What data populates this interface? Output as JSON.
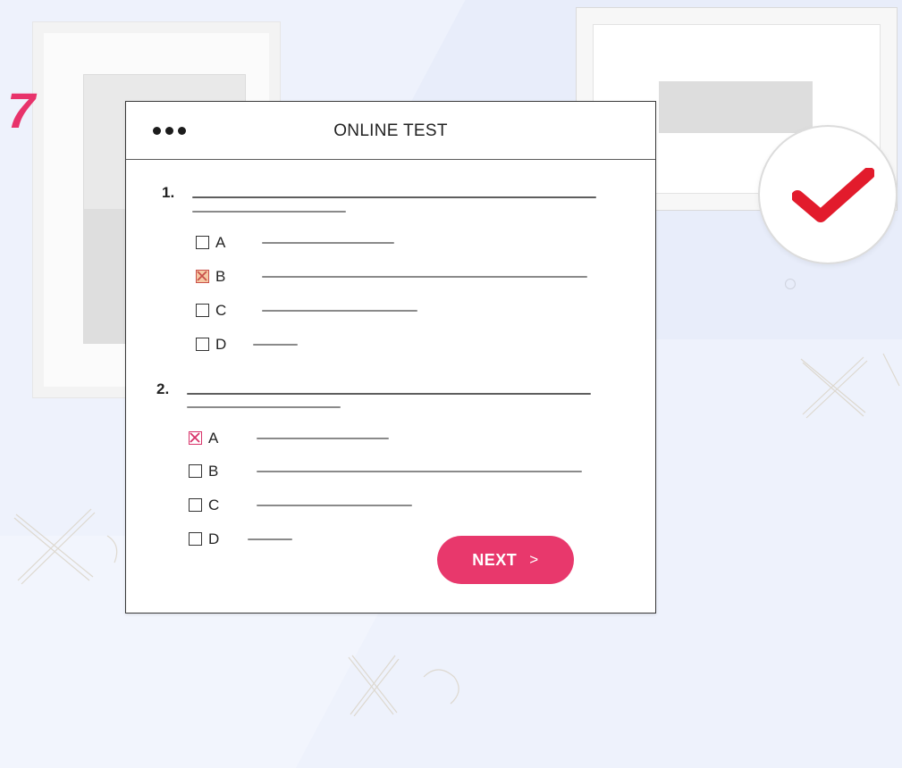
{
  "step_number": "7",
  "window": {
    "title": "ONLINE TEST"
  },
  "questions": [
    {
      "number": "1.",
      "options": [
        {
          "letter": "A",
          "state": "unchecked"
        },
        {
          "letter": "B",
          "state": "checked"
        },
        {
          "letter": "C",
          "state": "unchecked"
        },
        {
          "letter": "D",
          "state": "unchecked"
        }
      ]
    },
    {
      "number": "2.",
      "options": [
        {
          "letter": "A",
          "state": "checked"
        },
        {
          "letter": "B",
          "state": "unchecked"
        },
        {
          "letter": "C",
          "state": "unchecked"
        },
        {
          "letter": "D",
          "state": "unchecked"
        }
      ]
    }
  ],
  "next_button": {
    "label": "NEXT",
    "chevron": ">"
  },
  "colors": {
    "accent": "#e8386c",
    "check": "#e21b2c",
    "background": "#eef2fc"
  },
  "icons": {
    "checkmark": "checkmark-icon",
    "window_menu": "dots-icon"
  }
}
